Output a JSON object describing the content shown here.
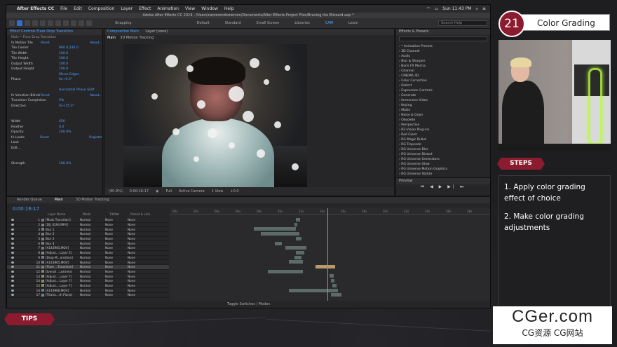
{
  "menubar": {
    "app_name": "After Effects CC",
    "items": [
      "File",
      "Edit",
      "Composition",
      "Layer",
      "Effect",
      "Animation",
      "View",
      "Window",
      "Help"
    ],
    "clock": "Sun 11:43 PM"
  },
  "window_title": "Adobe After Effects CC 2019 - /Users/camerondemerson/Documents/After Effects Project Files/Braving the Blizzard.aep *",
  "workspaces": [
    "Default",
    "Standard",
    "Small Screen",
    "Libraries",
    "CAM",
    "Learn"
  ],
  "workspace_active": "CAM",
  "search_placeholder": "Search Help",
  "effect_controls": {
    "tab": "Effect Controls Flare Drop Transition",
    "header": "Main • Flare Drop Transition",
    "rows": [
      {
        "label": "fx  Motion Tile",
        "value": "Reset",
        "value2": "About..."
      },
      {
        "label": "Tile Center",
        "value": "960.0,540.0"
      },
      {
        "label": "Tile Width",
        "value": "100.0"
      },
      {
        "label": "Tile Height",
        "value": "100.0"
      },
      {
        "label": "Output Width",
        "value": "100.0"
      },
      {
        "label": "Output Height",
        "value": "100.0"
      },
      {
        "label": "",
        "value": "Mirror Edges"
      },
      {
        "label": "Phase",
        "value": "0x+0.0°"
      },
      {
        "label": "",
        "value": ""
      },
      {
        "label": "",
        "value": "Horizontal Phase Shift"
      },
      {
        "label": "fx  Venetian Blinds",
        "value": "Reset",
        "value2": "About..."
      },
      {
        "label": "Transition Completion",
        "value": "0%"
      },
      {
        "label": "Direction",
        "value": "0x+55.0°"
      },
      {
        "label": "",
        "value": ""
      },
      {
        "label": "",
        "value": ""
      },
      {
        "label": "Width",
        "value": "450"
      },
      {
        "label": "Feather",
        "value": "0.0"
      },
      {
        "label": "Opacity",
        "value": "100.0%"
      },
      {
        "label": "fx  Looks",
        "value": "Reset",
        "value2": "Register"
      },
      {
        "label": "Look",
        "value": ""
      },
      {
        "label": "Edit...",
        "value": ""
      },
      {
        "label": "",
        "value": ""
      },
      {
        "label": "",
        "value": ""
      },
      {
        "label": "Strength",
        "value": "100.0%"
      }
    ]
  },
  "composition": {
    "tab": "Composition Main",
    "subtabs": [
      "Main",
      "3D Motion Tracking"
    ],
    "layer_tab": "Layer (none)",
    "snapping": "Snapping",
    "footer": [
      "(90.9%)",
      "0:00:16:17",
      "Full",
      "Active Camera",
      "1 View",
      "+0.0"
    ]
  },
  "effects_presets": {
    "title": "Effects & Presets",
    "items": [
      "* Animation Presets",
      "3D Channel",
      "Audio",
      "Blur & Sharpen",
      "Boris FX Mocha",
      "Channel",
      "CINEMA 4D",
      "Color Correction",
      "Distort",
      "Expression Controls",
      "Generate",
      "Immersive Video",
      "Keying",
      "Matte",
      "Noise & Grain",
      "Obsolete",
      "Perspective",
      "RE:Vision Plug-ins",
      "Red Giant",
      "RG Magic Bullet",
      "RG Trapcode",
      "RG Universe Blur",
      "RG Universe Distort",
      "RG Universe Generators",
      "RG Universe Glow",
      "RG Universe Motion Graphics",
      "RG Universe Stylize"
    ],
    "preview_title": "Preview"
  },
  "timeline": {
    "tabs": [
      "Render Queue",
      "Main",
      "3D Motion Tracking"
    ],
    "active_tab": "Main",
    "timecode": "0:00:16:17",
    "columns": [
      "Layer Name",
      "Mode",
      "TrkMat",
      "Parent & Link"
    ],
    "layers": [
      {
        "num": "1",
        "name": "[Mask Transition]",
        "mode": "Normal",
        "trk": "None",
        "parent": "None"
      },
      {
        "num": "2",
        "name": "[DJI_0294.MP4]",
        "mode": "Normal",
        "trk": "None",
        "parent": "None"
      },
      {
        "num": "3",
        "name": "Blur 1",
        "mode": "Normal",
        "trk": "None",
        "parent": "None"
      },
      {
        "num": "4",
        "name": "Blur 2",
        "mode": "Normal",
        "trk": "None",
        "parent": "None"
      },
      {
        "num": "5",
        "name": "Blur 3",
        "mode": "Normal",
        "trk": "None",
        "parent": "None"
      },
      {
        "num": "6",
        "name": "Blur 4",
        "mode": "Normal",
        "trk": "None",
        "parent": "None"
      },
      {
        "num": "7",
        "name": "[A143965.MOV]",
        "mode": "Normal",
        "trk": "None",
        "parent": "None"
      },
      {
        "num": "8",
        "name": "[Adjust... Layer 5]",
        "mode": "Normal",
        "trk": "None",
        "parent": "None"
      },
      {
        "num": "9",
        "name": "[Drop M...ansition]",
        "mode": "Normal",
        "trk": "None",
        "parent": "None"
      },
      {
        "num": "10",
        "name": "[A143965.MOV]",
        "mode": "Normal",
        "trk": "None",
        "parent": "None"
      },
      {
        "num": "11",
        "name": "[Flare ...Transition]",
        "mode": "Normal",
        "trk": "None",
        "parent": "None"
      },
      {
        "num": "12",
        "name": "Overall ...ustment",
        "mode": "Normal",
        "trk": "None",
        "parent": "None"
      },
      {
        "num": "13",
        "name": "[Adjust... Layer 7]",
        "mode": "Normal",
        "trk": "None",
        "parent": "None"
      },
      {
        "num": "14",
        "name": "[Adjust... Layer 7]",
        "mode": "Normal",
        "trk": "None",
        "parent": "None"
      },
      {
        "num": "15",
        "name": "[Adjust... Layer 7]",
        "mode": "Normal",
        "trk": "None",
        "parent": "None"
      },
      {
        "num": "16",
        "name": "[A143968.MOV]",
        "mode": "Normal",
        "trk": "None",
        "parent": "None"
      },
      {
        "num": "17",
        "name": "[Titanic...th Piano]",
        "mode": "Normal",
        "trk": "None",
        "parent": "None"
      }
    ],
    "ruler": [
      "00s",
      "02s",
      "04s",
      "06s",
      "08s",
      "10s",
      "12s",
      "14s",
      "16s",
      "18s",
      "20s",
      "22s",
      "24s",
      "26s",
      "28s"
    ],
    "footer": "Toggle Switches / Modes"
  },
  "tutorial": {
    "number": "21",
    "title": "Color Grading",
    "steps_label": "STEPS",
    "steps": [
      "1. Apply color grading effect of choice",
      "2. Make color grading adjustments"
    ],
    "tips_label": "TIPS"
  },
  "watermark": {
    "main": "CGer.com",
    "sub": "CG资源 CG网站"
  }
}
